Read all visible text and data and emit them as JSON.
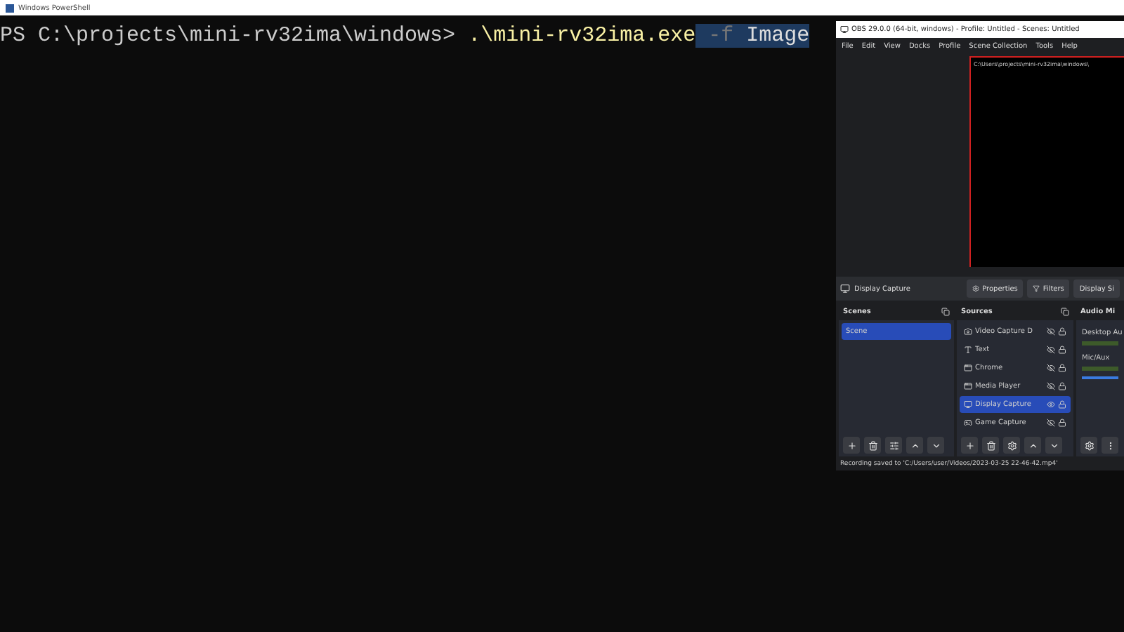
{
  "terminal": {
    "title": "Windows PowerShell",
    "prompt": "PS C:\\projects\\mini-rv32ima\\windows> ",
    "command": ".\\mini-rv32ima.exe",
    "flag": "-f",
    "argument": "Image"
  },
  "obs": {
    "title": "OBS 29.0.0 (64-bit, windows) - Profile: Untitled - Scenes: Untitled",
    "menu": [
      "File",
      "Edit",
      "View",
      "Docks",
      "Profile",
      "Scene Collection",
      "Tools",
      "Help"
    ],
    "preview_text": "C:\\Users\\projects\\mini-rv32ima\\windows\\",
    "source_label": "Display Capture",
    "toolbar_buttons": [
      "Properties",
      "Filters",
      "Display Si"
    ],
    "scenes": {
      "title": "Scenes",
      "items": [
        {
          "label": "Scene",
          "selected": true
        }
      ]
    },
    "sources": {
      "title": "Sources",
      "items": [
        {
          "label": "Video Capture D",
          "kind": "camera",
          "selected": false
        },
        {
          "label": "Text",
          "kind": "text",
          "selected": false
        },
        {
          "label": "Chrome",
          "kind": "window",
          "selected": false
        },
        {
          "label": "Media Player",
          "kind": "window",
          "selected": false
        },
        {
          "label": "Display Capture",
          "kind": "display",
          "selected": true
        },
        {
          "label": "Game Capture",
          "kind": "game",
          "selected": false
        }
      ]
    },
    "mixer": {
      "title": "Audio Mi",
      "channels": [
        {
          "name": "Desktop Au"
        },
        {
          "name": "Mic/Aux",
          "level": 1
        }
      ]
    },
    "status": "Recording saved to 'C:/Users/user/Videos/2023-03-25 22-46-42.mp4'"
  }
}
